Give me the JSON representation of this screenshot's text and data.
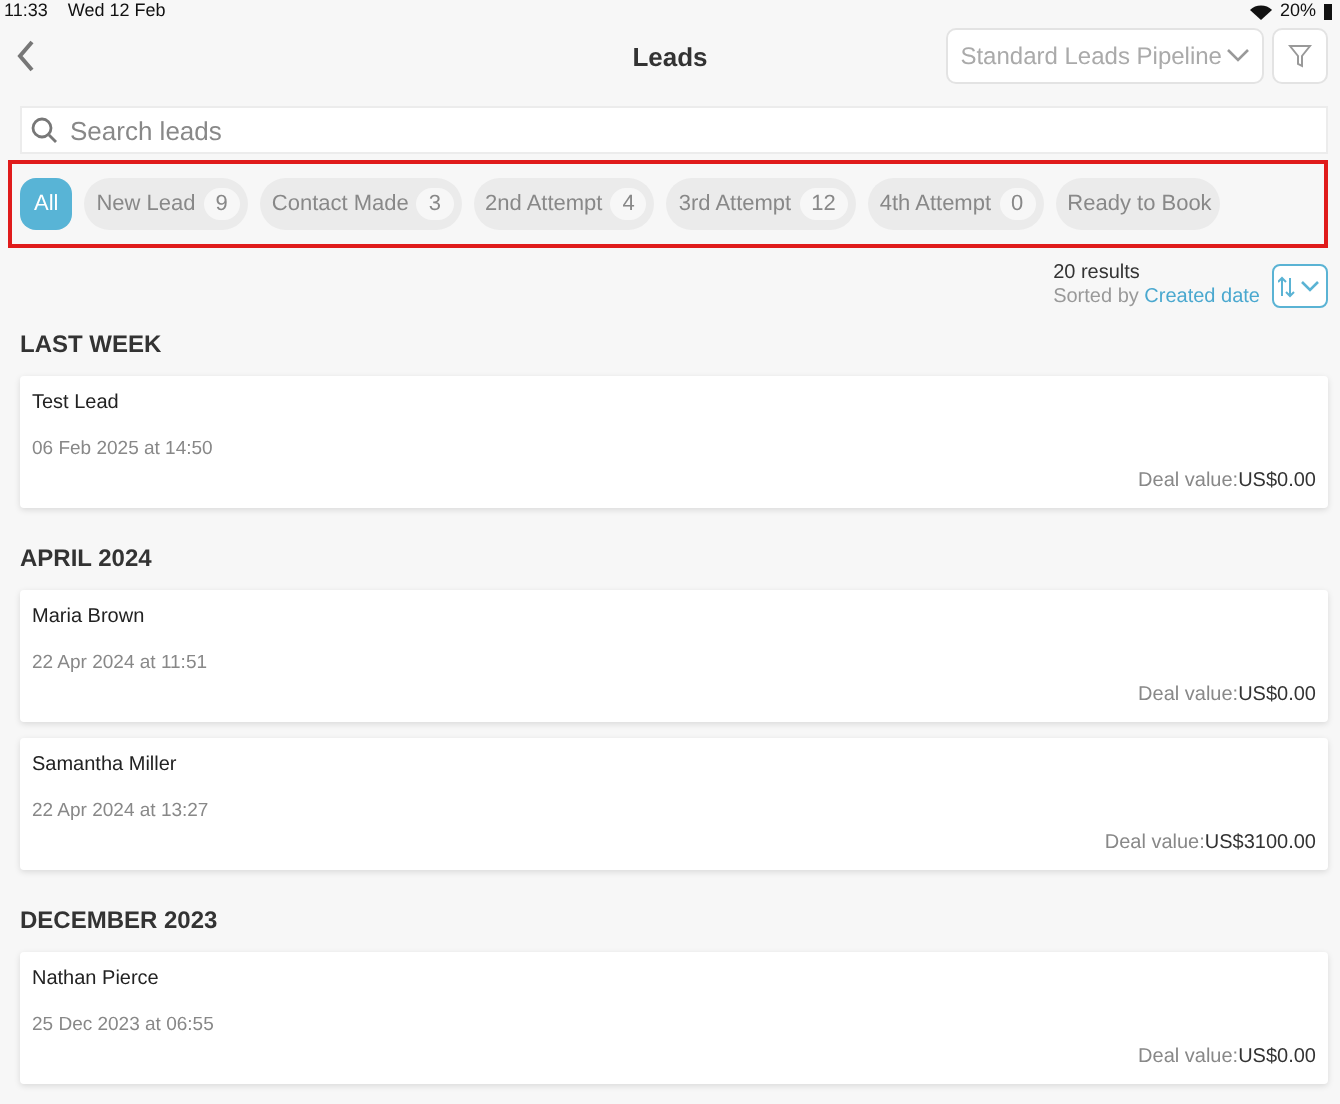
{
  "status_bar": {
    "time": "11:33",
    "date": "Wed 12 Feb",
    "battery": "20%"
  },
  "header": {
    "title": "Leads",
    "pipeline": "Standard Leads Pipeline"
  },
  "search": {
    "placeholder": "Search leads"
  },
  "stages": [
    {
      "label": "All",
      "selected": true
    },
    {
      "label": "New Lead",
      "count": "9",
      "selected": false
    },
    {
      "label": "Contact Made",
      "count": "3",
      "selected": false
    },
    {
      "label": "2nd Attempt",
      "count": "4",
      "selected": false
    },
    {
      "label": "3rd Attempt",
      "count": "12",
      "selected": false
    },
    {
      "label": "4th Attempt",
      "count": "0",
      "selected": false
    },
    {
      "label": "Ready to Book",
      "selected": false
    }
  ],
  "results": {
    "count": "20 results",
    "sorted_label": "Sorted by",
    "sort_field": "Created date"
  },
  "sections": [
    {
      "title": "LAST WEEK",
      "leads": [
        {
          "name": "Test Lead",
          "date": "06 Feb 2025 at 14:50",
          "deal_label": "Deal value:",
          "deal_value": "US$0.00"
        }
      ]
    },
    {
      "title": "APRIL 2024",
      "leads": [
        {
          "name": "Maria  Brown",
          "date": "22 Apr 2024 at 11:51",
          "deal_label": "Deal value:",
          "deal_value": "US$0.00"
        },
        {
          "name": "Samantha  Miller",
          "date": "22 Apr 2024 at 13:27",
          "deal_label": "Deal value:",
          "deal_value": "US$3100.00"
        }
      ]
    },
    {
      "title": "DECEMBER 2023",
      "leads": [
        {
          "name": "Nathan  Pierce",
          "date": "25 Dec 2023 at 06:55",
          "deal_label": "Deal value:",
          "deal_value": "US$0.00"
        }
      ]
    }
  ]
}
